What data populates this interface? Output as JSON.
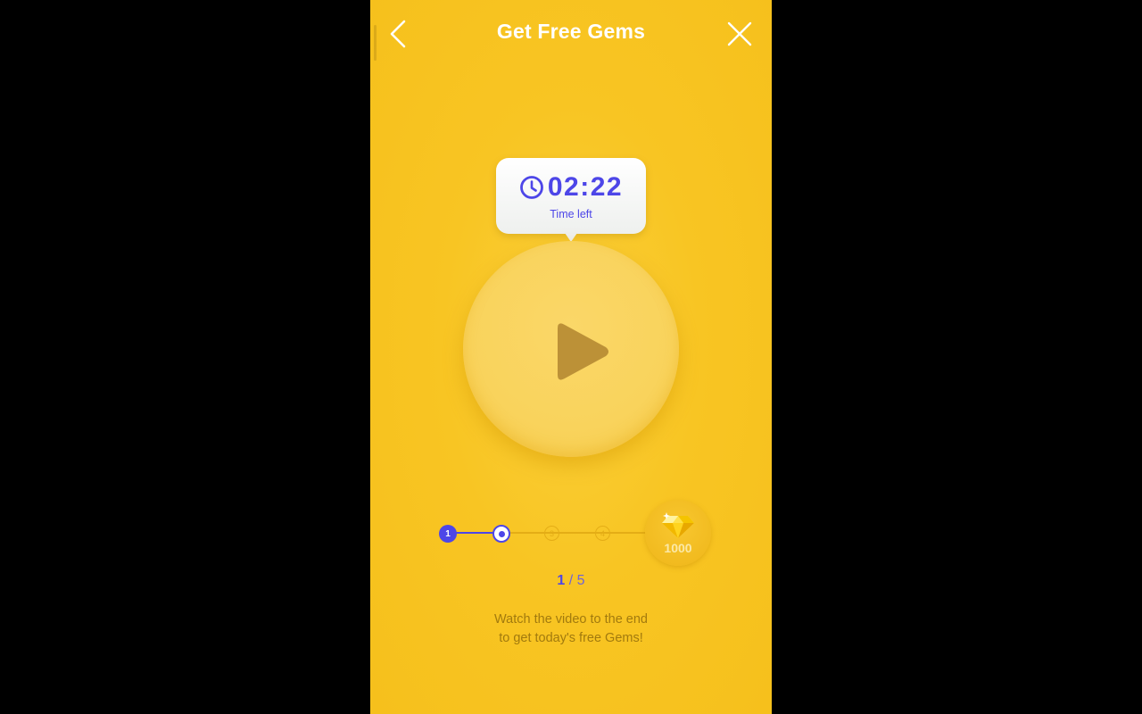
{
  "header": {
    "title": "Get Free Gems",
    "back_icon": "chevron-left-icon",
    "close_icon": "close-icon"
  },
  "timer": {
    "icon": "clock-icon",
    "value": "02:22",
    "label": "Time left"
  },
  "video": {
    "play_icon": "play-icon"
  },
  "progress": {
    "steps": [
      {
        "label": "1",
        "state": "done"
      },
      {
        "label": "",
        "state": "current"
      },
      {
        "label": "3",
        "state": "upcoming"
      },
      {
        "label": "4",
        "state": "upcoming"
      }
    ],
    "reward_icon": "gem-icon",
    "reward_amount": "1000",
    "current": "1",
    "total": "/ 5"
  },
  "instructions": {
    "line1": "Watch the video to the end",
    "line2": "to get today's free Gems!"
  },
  "colors": {
    "background": "#f8c523",
    "accent": "#4d46e8",
    "muted_text": "#a27a0e",
    "white": "#ffffff"
  }
}
